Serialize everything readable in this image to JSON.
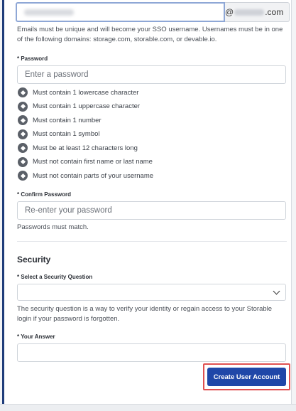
{
  "email": {
    "domain_prefix": "@",
    "domain_suffix": ".com",
    "help": "Emails must be unique and will become your SSO username. Usernames must be in one of the following domains: storage.com, storable.com, or devable.io."
  },
  "password": {
    "label": "* Password",
    "placeholder": "Enter a password",
    "rules": [
      "Must contain 1 lowercase character",
      "Must contain 1 uppercase character",
      "Must contain 1 number",
      "Must contain 1 symbol",
      "Must be at least 12 characters long",
      "Must not contain first name or last name",
      "Must not contain parts of your username"
    ],
    "rule_icon": "diamond-circle-icon"
  },
  "confirm": {
    "label": "* Confirm Password",
    "placeholder": "Re-enter your password",
    "help": "Passwords must match."
  },
  "security": {
    "title": "Security",
    "question_label": "* Select a Security Question",
    "question_value": "",
    "help": "The security question is a way to verify your identity or regain access to your Storable login if your password is forgotten.",
    "answer_label": "* Your Answer",
    "answer_value": ""
  },
  "actions": {
    "submit_label": "Create User Account",
    "submit_color": "#1f47a8",
    "highlight_color": "#e05050"
  }
}
